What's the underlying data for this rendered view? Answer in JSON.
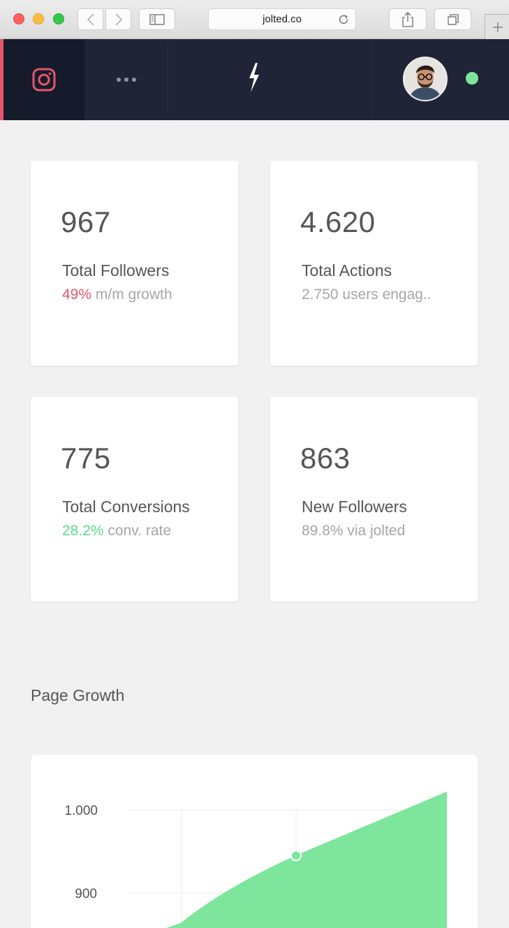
{
  "browser": {
    "url": "jolted.co"
  },
  "header": {
    "active_network": "instagram",
    "status": "online",
    "colors": {
      "accent": "#e7556e",
      "status": "#7ee59c",
      "bar": "#1f2436"
    }
  },
  "stats": [
    {
      "value": "967",
      "label": "Total Followers",
      "highlight": "49%",
      "sub": " m/m growth",
      "highlight_color": "red"
    },
    {
      "value": "4.620",
      "label": "Total Actions",
      "highlight": "",
      "sub": "2.750 users engag..",
      "highlight_color": ""
    },
    {
      "value": "775",
      "label": "Total Conversions",
      "highlight": "28.2%",
      "sub": " conv. rate",
      "highlight_color": "green"
    },
    {
      "value": "863",
      "label": "New Followers",
      "highlight": "",
      "sub": "89.8% via jolted",
      "highlight_color": ""
    }
  ],
  "growth": {
    "title": "Page Growth"
  },
  "chart_data": {
    "type": "area",
    "title": "",
    "xlabel": "",
    "ylabel": "",
    "y_ticks": [
      "1.000",
      "900"
    ],
    "ylim": [
      800,
      1000
    ],
    "x": [
      0,
      1,
      2,
      3
    ],
    "series": [
      {
        "values": [
          null,
          840,
          945,
          978
        ],
        "color": "#7ee59c"
      }
    ],
    "grid": true
  }
}
